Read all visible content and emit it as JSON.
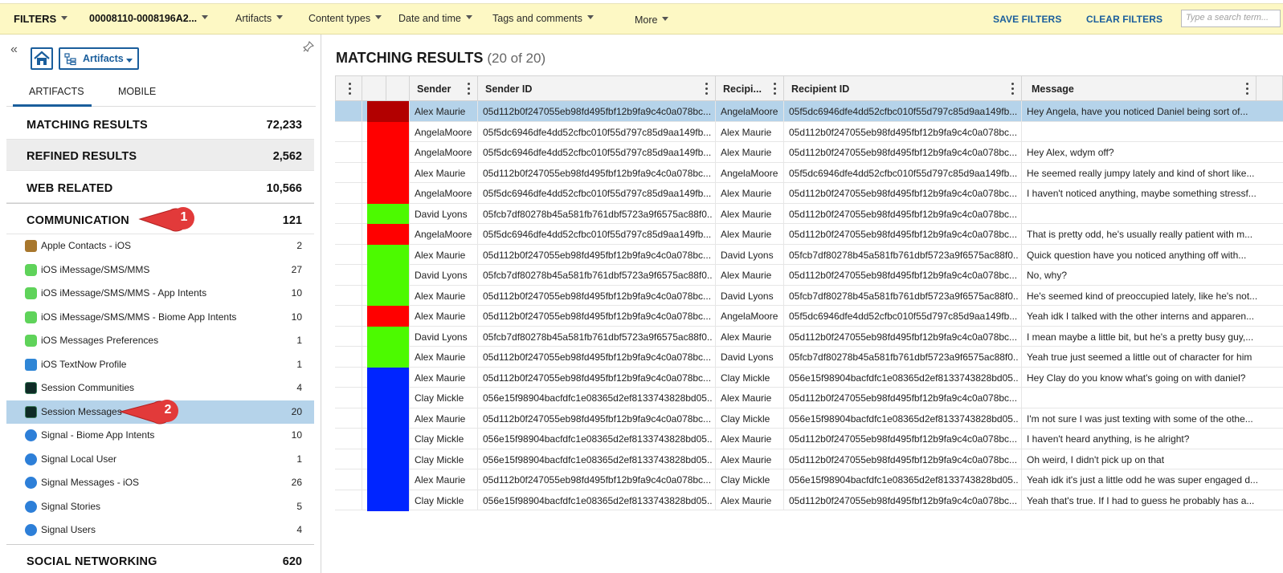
{
  "filterbar": {
    "filters_label": "FILTERS",
    "case_label": "00008110-0008196A2...",
    "artifacts_label": "Artifacts",
    "content_types_label": "Content types",
    "date_time_label": "Date and time",
    "tags_label": "Tags and comments",
    "more_label": "More",
    "save_filters": "SAVE FILTERS",
    "clear_filters": "CLEAR FILTERS",
    "search_placeholder": "Type a search term..."
  },
  "left": {
    "dropdown_label": "Artifacts",
    "tabs": [
      "ARTIFACTS",
      "MOBILE"
    ],
    "categories": [
      {
        "name": "MATCHING RESULTS",
        "count": "72,233"
      },
      {
        "name": "REFINED RESULTS",
        "count": "2,562"
      },
      {
        "name": "WEB RELATED",
        "count": "10,566"
      },
      {
        "name": "COMMUNICATION",
        "count": "121"
      },
      {
        "name": "SOCIAL NETWORKING",
        "count": "620"
      }
    ],
    "subitems": [
      {
        "name": "Apple Contacts - iOS",
        "count": "2",
        "icon": "contacts-icon"
      },
      {
        "name": "iOS iMessage/SMS/MMS",
        "count": "27",
        "icon": "message-bubble-icon"
      },
      {
        "name": "iOS iMessage/SMS/MMS - App Intents",
        "count": "10",
        "icon": "message-bubble-icon"
      },
      {
        "name": "iOS iMessage/SMS/MMS - Biome App Intents",
        "count": "10",
        "icon": "message-bubble-icon"
      },
      {
        "name": "iOS Messages Preferences",
        "count": "1",
        "icon": "message-bubble-icon"
      },
      {
        "name": "iOS TextNow Profile",
        "count": "1",
        "icon": "textnow-icon"
      },
      {
        "name": "Session Communities",
        "count": "4",
        "icon": "session-icon"
      },
      {
        "name": "Session Messages",
        "count": "20",
        "icon": "session-icon"
      },
      {
        "name": "Signal - Biome App Intents",
        "count": "10",
        "icon": "signal-icon"
      },
      {
        "name": "Signal Local User",
        "count": "1",
        "icon": "signal-icon"
      },
      {
        "name": "Signal Messages - iOS",
        "count": "26",
        "icon": "signal-icon"
      },
      {
        "name": "Signal Stories",
        "count": "5",
        "icon": "signal-icon"
      },
      {
        "name": "Signal Users",
        "count": "4",
        "icon": "signal-icon"
      }
    ],
    "callout1": "1",
    "callout2": "2"
  },
  "results": {
    "title": "MATCHING RESULTS",
    "count_text": "(20 of 20)",
    "columns": [
      "Sender",
      "Sender ID",
      "Recipi...",
      "Recipient ID",
      "Message"
    ],
    "colors": {
      "darkred": "#b20000",
      "red": "#ff0000",
      "green": "#4cfa00",
      "blue": "#0025ff"
    },
    "rows": [
      {
        "color": "darkred",
        "sender": "Alex Maurie",
        "sender_id": "05d112b0f247055eb98fd495fbf12b9fa9c4c0a078bc...",
        "recipient": "AngelaMoore",
        "recipient_id": "05f5dc6946dfe4dd52cfbc010f55d797c85d9aa149fb...",
        "message": "Hey Angela, have you noticed Daniel being sort of..."
      },
      {
        "color": "red",
        "sender": "AngelaMoore",
        "sender_id": "05f5dc6946dfe4dd52cfbc010f55d797c85d9aa149fb...",
        "recipient": "Alex Maurie",
        "recipient_id": "05d112b0f247055eb98fd495fbf12b9fa9c4c0a078bc...",
        "message": ""
      },
      {
        "color": "red",
        "sender": "AngelaMoore",
        "sender_id": "05f5dc6946dfe4dd52cfbc010f55d797c85d9aa149fb...",
        "recipient": "Alex Maurie",
        "recipient_id": "05d112b0f247055eb98fd495fbf12b9fa9c4c0a078bc...",
        "message": "Hey Alex, wdym off?"
      },
      {
        "color": "red",
        "sender": "Alex Maurie",
        "sender_id": "05d112b0f247055eb98fd495fbf12b9fa9c4c0a078bc...",
        "recipient": "AngelaMoore",
        "recipient_id": "05f5dc6946dfe4dd52cfbc010f55d797c85d9aa149fb...",
        "message": "He seemed really jumpy lately and kind of short like..."
      },
      {
        "color": "red",
        "sender": "AngelaMoore",
        "sender_id": "05f5dc6946dfe4dd52cfbc010f55d797c85d9aa149fb...",
        "recipient": "Alex Maurie",
        "recipient_id": "05d112b0f247055eb98fd495fbf12b9fa9c4c0a078bc...",
        "message": "I haven't noticed anything, maybe something stressf..."
      },
      {
        "color": "green",
        "sender": "David Lyons",
        "sender_id": "05fcb7df80278b45a581fb761dbf5723a9f6575ac88f0...",
        "recipient": "Alex Maurie",
        "recipient_id": "05d112b0f247055eb98fd495fbf12b9fa9c4c0a078bc...",
        "message": ""
      },
      {
        "color": "red",
        "sender": "AngelaMoore",
        "sender_id": "05f5dc6946dfe4dd52cfbc010f55d797c85d9aa149fb...",
        "recipient": "Alex Maurie",
        "recipient_id": "05d112b0f247055eb98fd495fbf12b9fa9c4c0a078bc...",
        "message": "That is pretty odd, he's usually really patient with m..."
      },
      {
        "color": "green",
        "sender": "Alex Maurie",
        "sender_id": "05d112b0f247055eb98fd495fbf12b9fa9c4c0a078bc...",
        "recipient": "David Lyons",
        "recipient_id": "05fcb7df80278b45a581fb761dbf5723a9f6575ac88f0...",
        "message": "Quick question have you noticed anything off with..."
      },
      {
        "color": "green",
        "sender": "David Lyons",
        "sender_id": "05fcb7df80278b45a581fb761dbf5723a9f6575ac88f0...",
        "recipient": "Alex Maurie",
        "recipient_id": "05d112b0f247055eb98fd495fbf12b9fa9c4c0a078bc...",
        "message": "No, why?"
      },
      {
        "color": "green",
        "sender": "Alex Maurie",
        "sender_id": "05d112b0f247055eb98fd495fbf12b9fa9c4c0a078bc...",
        "recipient": "David Lyons",
        "recipient_id": "05fcb7df80278b45a581fb761dbf5723a9f6575ac88f0...",
        "message": "He's seemed kind of preoccupied lately, like he's not..."
      },
      {
        "color": "red",
        "sender": "Alex Maurie",
        "sender_id": "05d112b0f247055eb98fd495fbf12b9fa9c4c0a078bc...",
        "recipient": "AngelaMoore",
        "recipient_id": "05f5dc6946dfe4dd52cfbc010f55d797c85d9aa149fb...",
        "message": "Yeah idk I talked with the other interns and apparen..."
      },
      {
        "color": "green",
        "sender": "David Lyons",
        "sender_id": "05fcb7df80278b45a581fb761dbf5723a9f6575ac88f0...",
        "recipient": "Alex Maurie",
        "recipient_id": "05d112b0f247055eb98fd495fbf12b9fa9c4c0a078bc...",
        "message": "I mean maybe a little bit, but he's a pretty busy guy,..."
      },
      {
        "color": "green",
        "sender": "Alex Maurie",
        "sender_id": "05d112b0f247055eb98fd495fbf12b9fa9c4c0a078bc...",
        "recipient": "David Lyons",
        "recipient_id": "05fcb7df80278b45a581fb761dbf5723a9f6575ac88f0...",
        "message": "Yeah true just seemed a little out of character for him"
      },
      {
        "color": "blue",
        "sender": "Alex Maurie",
        "sender_id": "05d112b0f247055eb98fd495fbf12b9fa9c4c0a078bc...",
        "recipient": "Clay Mickle",
        "recipient_id": "056e15f98904bacfdfc1e08365d2ef8133743828bd05...",
        "message": "Hey Clay do you know what's going on with daniel?"
      },
      {
        "color": "blue",
        "sender": "Clay Mickle",
        "sender_id": "056e15f98904bacfdfc1e08365d2ef8133743828bd05...",
        "recipient": "Alex Maurie",
        "recipient_id": "05d112b0f247055eb98fd495fbf12b9fa9c4c0a078bc...",
        "message": ""
      },
      {
        "color": "blue",
        "sender": "Alex Maurie",
        "sender_id": "05d112b0f247055eb98fd495fbf12b9fa9c4c0a078bc...",
        "recipient": "Clay Mickle",
        "recipient_id": "056e15f98904bacfdfc1e08365d2ef8133743828bd05...",
        "message": "I'm not sure I was just texting with some of the othe..."
      },
      {
        "color": "blue",
        "sender": "Clay Mickle",
        "sender_id": "056e15f98904bacfdfc1e08365d2ef8133743828bd05...",
        "recipient": "Alex Maurie",
        "recipient_id": "05d112b0f247055eb98fd495fbf12b9fa9c4c0a078bc...",
        "message": "I haven't heard anything, is he alright?"
      },
      {
        "color": "blue",
        "sender": "Clay Mickle",
        "sender_id": "056e15f98904bacfdfc1e08365d2ef8133743828bd05...",
        "recipient": "Alex Maurie",
        "recipient_id": "05d112b0f247055eb98fd495fbf12b9fa9c4c0a078bc...",
        "message": "Oh weird, I didn't pick up on that"
      },
      {
        "color": "blue",
        "sender": "Alex Maurie",
        "sender_id": "05d112b0f247055eb98fd495fbf12b9fa9c4c0a078bc...",
        "recipient": "Clay Mickle",
        "recipient_id": "056e15f98904bacfdfc1e08365d2ef8133743828bd05...",
        "message": "Yeah idk it's just a little odd he was super engaged d..."
      },
      {
        "color": "blue",
        "sender": "Clay Mickle",
        "sender_id": "056e15f98904bacfdfc1e08365d2ef8133743828bd05...",
        "recipient": "Alex Maurie",
        "recipient_id": "05d112b0f247055eb98fd495fbf12b9fa9c4c0a078bc...",
        "message": "Yeah that's true. If I had to guess he probably has a..."
      }
    ]
  }
}
